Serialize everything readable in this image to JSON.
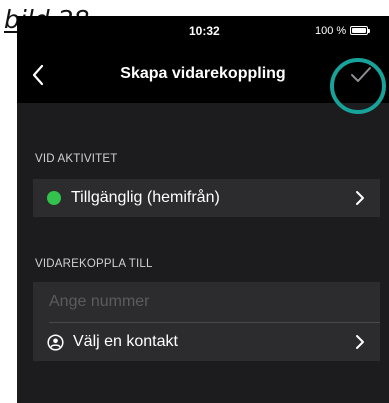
{
  "caption": "bild 28",
  "status_bar": {
    "time": "10:32",
    "battery": "100 %"
  },
  "nav": {
    "title": "Skapa vidarekoppling",
    "back_icon": "chevron-left-icon",
    "confirm_icon": "checkmark-icon"
  },
  "on_activity": {
    "header": "VID AKTIVITET",
    "selected": "Tillgänglig (hemifrån)",
    "status_color": "#33c24d"
  },
  "forward_to": {
    "header": "VIDAREKOPPLA TILL",
    "number_value": "",
    "number_placeholder": "Ange nummer",
    "contact_label": "Välj en kontakt",
    "contact_icon": "person-circle-icon"
  },
  "colors": {
    "highlight": "#17a39a",
    "background": "#1c1c1e",
    "row": "#2c2c2e"
  }
}
